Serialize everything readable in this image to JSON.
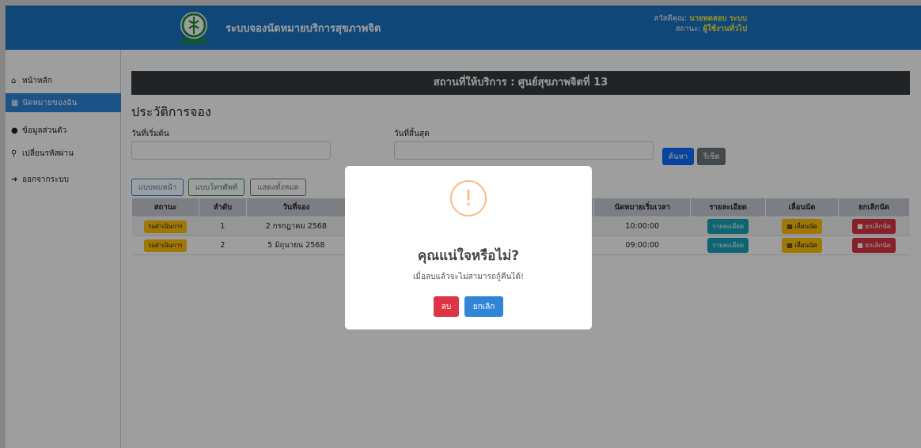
{
  "header": {
    "title": "ระบบจองนัดหมายบริการสุขภาพจิต",
    "greeting_prefix": "สวัสดีคุณ:",
    "user_name": "นายทดสอบ ระบบ",
    "status_prefix": "สถานะ:",
    "user_status": "ผู้ใช้งานทั่วไป",
    "brand_color": "#1b73c4"
  },
  "sidebar": {
    "items": [
      {
        "label": "หน้าหลัก",
        "icon": "home-icon"
      },
      {
        "label": "นัดหมายของฉัน",
        "icon": "calendar-icon",
        "active": true
      },
      {
        "label": "ข้อมูลส่วนตัว",
        "icon": "user-icon"
      },
      {
        "label": "เปลี่ยนรหัสผ่าน",
        "icon": "key-icon"
      },
      {
        "label": "ออกจากระบบ",
        "icon": "sign-out-icon"
      }
    ]
  },
  "main": {
    "branch": "สถานที่ให้บริการ : ศูนย์สุขภาพจิตที่ 13",
    "page_title": "ประวัติการจอง",
    "start_date_label": "วันที่เริ่มต้น",
    "end_date_label": "วันที่สิ้นสุด",
    "search_label": "ค้นหา",
    "reset_label": "รีเซ็ต",
    "filters": [
      "แบบพบหน้า",
      "แบบโทรศัพท์",
      "แสดงทั้งหมด"
    ],
    "table": {
      "headers": [
        "สถานะ",
        "ลำดับ",
        "วันที่จอง",
        "",
        "นัดหมายเริ่มเวลา",
        "รายละเอียด",
        "เลื่อนนัด",
        "ยกเลิกนัด"
      ],
      "rows": [
        {
          "status": "รอดำเนินการ",
          "no": "1",
          "date": "2 กรกฎาคม 2568",
          "time": "10:00:00",
          "detail": "รายละเอียด",
          "postpone": "เลื่อนนัด",
          "cancel": "ยกเลิกนัด"
        },
        {
          "status": "รอดำเนินการ",
          "no": "2",
          "date": "5 มิถุนายน 2568",
          "time": "09:00:00",
          "detail": "รายละเอียด",
          "postpone": "เลื่อนนัด",
          "cancel": "ยกเลิกนัด"
        }
      ]
    }
  },
  "modal": {
    "icon": "!",
    "title": "คุณแน่ใจหรือไม่?",
    "text": "เมื่อลบแล้วจะไม่สามารถกู้คืนได้!",
    "confirm_label": "ลบ",
    "cancel_label": "ยกเลิก"
  }
}
